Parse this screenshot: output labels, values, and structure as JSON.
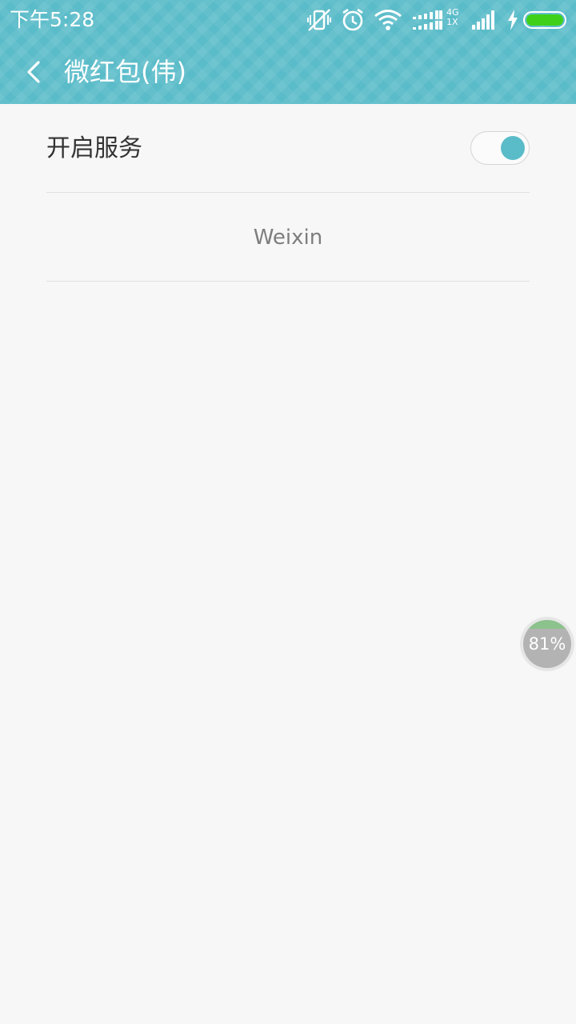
{
  "status_bar": {
    "time": "下午5:28",
    "icons": [
      "vibrate-off-icon",
      "alarm-icon",
      "wifi-icon",
      "dual-signal-icon",
      "signal-icon",
      "charging-icon",
      "battery-icon"
    ],
    "network_top": "4G",
    "network_bottom": "1X",
    "battery_fill_fraction": 1.0,
    "battery_color": "#3fd11a"
  },
  "header": {
    "title": "微红包(伟)",
    "background_color": "#5bbcc9"
  },
  "settings": {
    "service_label": "开启服务",
    "service_enabled": true,
    "accent_color": "#5bbcc9",
    "items": [
      {
        "label": "Weixin"
      }
    ]
  },
  "floating_widget": {
    "label": "81%",
    "fill_percent": 81
  }
}
